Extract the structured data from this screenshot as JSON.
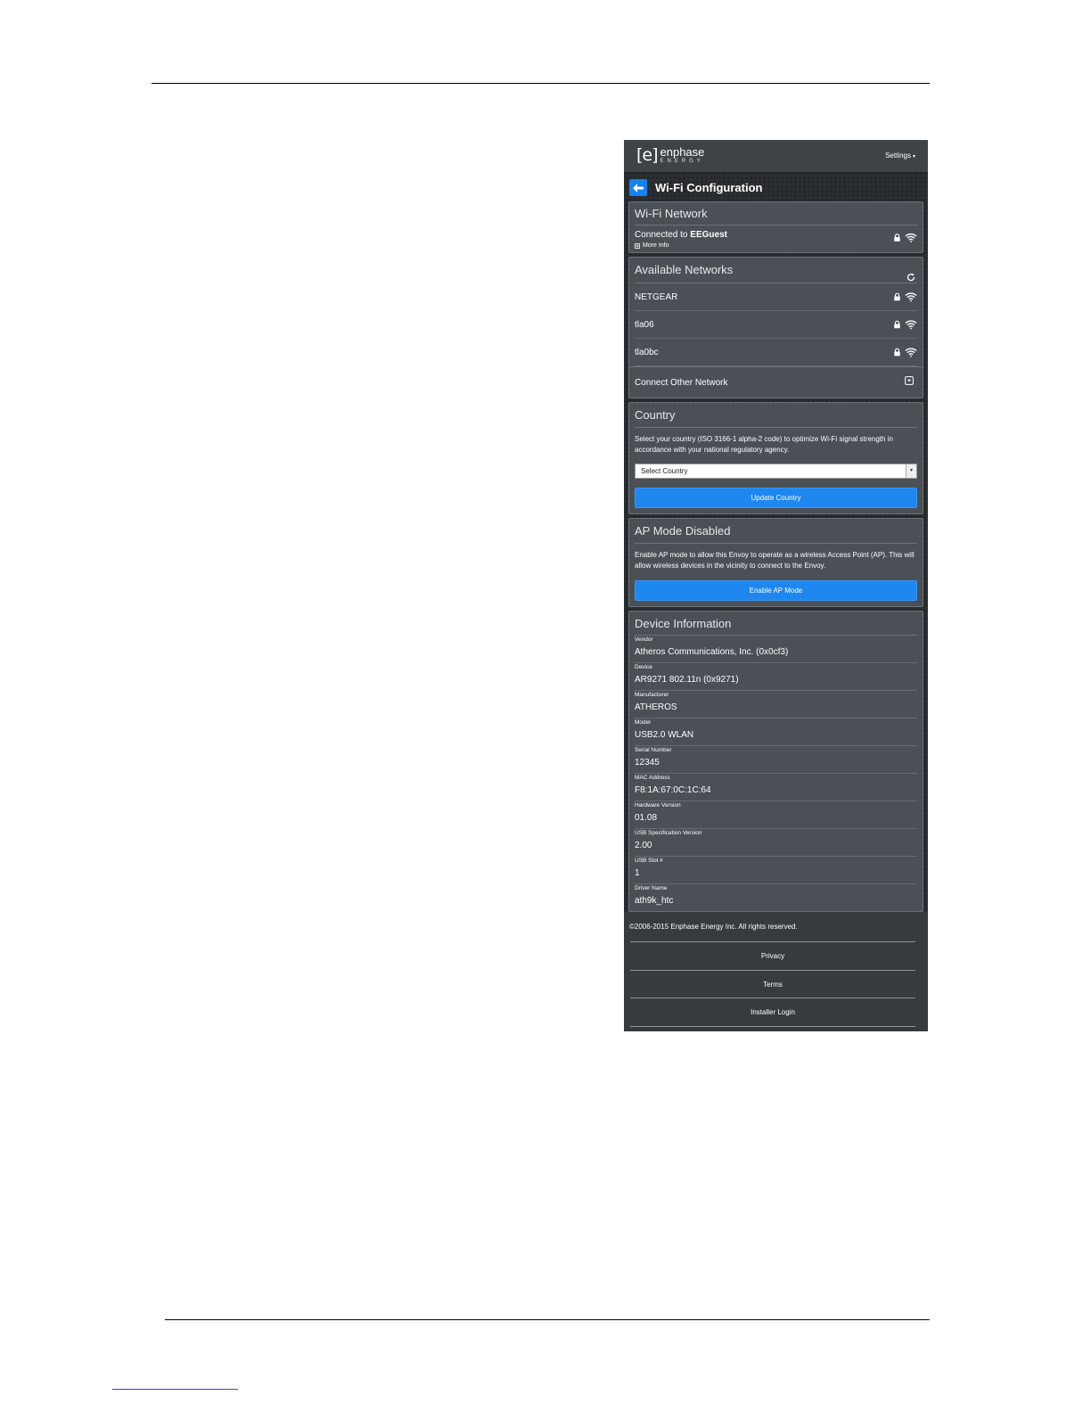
{
  "header": {
    "logo_bracket": "[e]",
    "logo_word": "enphase",
    "logo_sub": "ENERGY",
    "settings_label": "Settings"
  },
  "page": {
    "title": "Wi-Fi Configuration"
  },
  "wifi_network": {
    "title": "Wi-Fi Network",
    "connected_prefix": "Connected to",
    "ssid": "EEGuest",
    "more_info": "More Info"
  },
  "available_networks": {
    "title": "Available Networks",
    "networks": [
      {
        "ssid": "NETGEAR"
      },
      {
        "ssid": "tla06"
      },
      {
        "ssid": "tla0bc"
      }
    ],
    "connect_other": "Connect Other Network"
  },
  "country": {
    "title": "Country",
    "description": "Select your country (ISO 3166-1 alpha-2 code) to optimize Wi-Fi signal strength in accordance with your national regulatory agency.",
    "select_placeholder": "Select Country",
    "update_button": "Update Country"
  },
  "ap_mode": {
    "title": "AP Mode Disabled",
    "description": "Enable AP mode to allow this Envoy to operate as a wireless Access Point (AP). This will allow wireless devices in the vicinity to connect to the Envoy.",
    "enable_button": "Enable AP Mode"
  },
  "device_info": {
    "title": "Device Information",
    "fields": [
      {
        "label": "Vendor",
        "value": "Atheros Communications, Inc. (0x0cf3)"
      },
      {
        "label": "Device",
        "value": "AR9271 802.11n (0x9271)"
      },
      {
        "label": "Manufacturer",
        "value": "ATHEROS"
      },
      {
        "label": "Model",
        "value": "USB2.0 WLAN"
      },
      {
        "label": "Serial Number",
        "value": "12345"
      },
      {
        "label": "MAC Address",
        "value": "F8:1A:67:0C:1C:64"
      },
      {
        "label": "Hardware Version",
        "value": "01.08"
      },
      {
        "label": "USB Specification Version",
        "value": "2.00"
      },
      {
        "label": "USB Slot #",
        "value": "1"
      },
      {
        "label": "Driver Name",
        "value": "ath9k_htc"
      }
    ]
  },
  "footer": {
    "copyright": "©2006-2015 Enphase Energy Inc. All rights reserved.",
    "links": [
      "Privacy",
      "Terms",
      "Installer Login"
    ]
  },
  "colors": {
    "accent": "#1e87f0",
    "panel": "#4a5055",
    "background": "#2b2f31"
  }
}
